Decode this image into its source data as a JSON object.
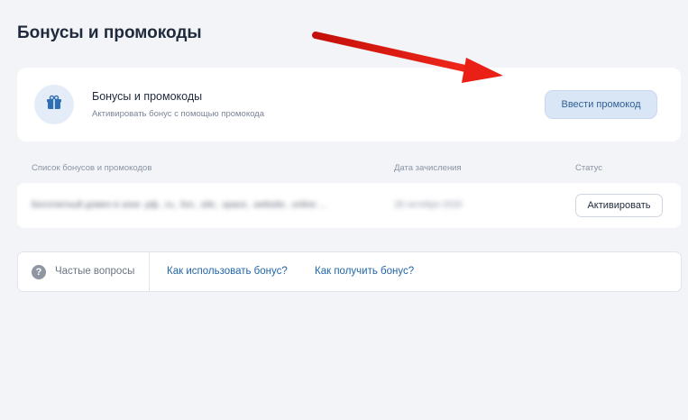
{
  "page": {
    "title": "Бонусы и промокоды"
  },
  "promo_card": {
    "icon": "gift-box-icon",
    "title": "Бонусы и промокоды",
    "subtitle": "Активировать бонус с помощью промокода",
    "button_label": "Ввести промокод"
  },
  "table": {
    "columns": [
      "Список бонусов и промокодов",
      "Дата зачисления",
      "Статус"
    ],
    "rows": [
      {
        "name": "Бесплатный домен в зоне .рф, .ru, .fun, .site, .space, .website, .online ...",
        "date": "28 октября 2020",
        "action_label": "Активировать"
      }
    ]
  },
  "faq": {
    "icon": "question-circle-icon",
    "label": "Частые вопросы",
    "links": [
      "Как использовать бонус?",
      "Как получить бонус?"
    ]
  },
  "annotation": {
    "icon": "red-arrow-icon",
    "color": "#e31b12"
  },
  "colors": {
    "background": "#f3f4f7",
    "card": "#ffffff",
    "primary_button_bg": "#d8e6f5",
    "primary_button_text": "#2f5f97",
    "link": "#2266aa"
  }
}
